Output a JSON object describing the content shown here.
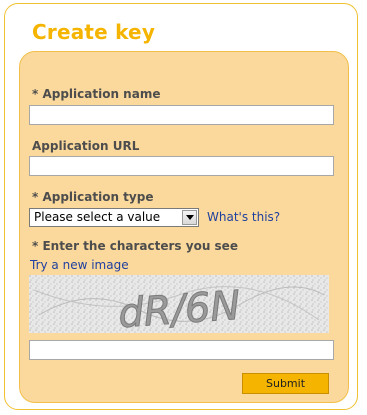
{
  "form": {
    "title": "Create key",
    "app_name": {
      "label": "* Application name",
      "value": ""
    },
    "app_url": {
      "label": "Application URL",
      "value": ""
    },
    "app_type": {
      "label": "* Application type",
      "selected": "Please select a value",
      "help_link": "What's this?"
    },
    "captcha": {
      "label": "* Enter the characters you see",
      "refresh_link": "Try a new image",
      "image_text": "dR/6N",
      "value": ""
    },
    "submit_label": "Submit"
  },
  "colors": {
    "accent": "#f5b400",
    "panel": "#fbd99c",
    "link": "#2040a0"
  }
}
